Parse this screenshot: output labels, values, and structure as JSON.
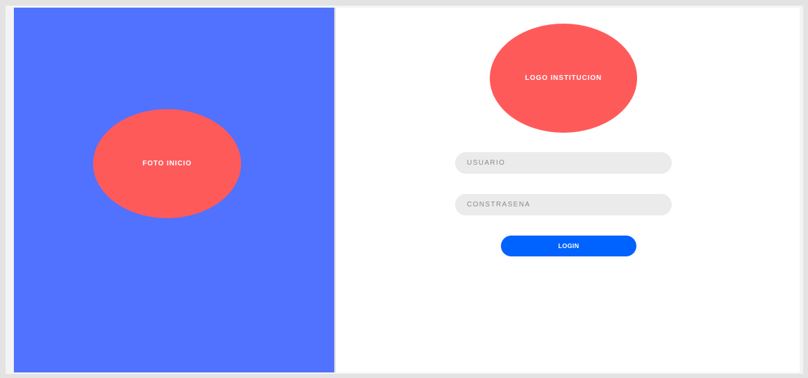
{
  "left_panel": {
    "photo_label": "FOTO INICIO",
    "background_color": "#5171ff",
    "ellipse_color": "#ff5a5a"
  },
  "right_panel": {
    "logo_label": "LOGO INSTITUCION",
    "username": {
      "placeholder": "USUARIO",
      "value": ""
    },
    "password": {
      "placeholder": "CONSTRASEÑA",
      "value": ""
    },
    "login_button": {
      "label": "LOGIN",
      "color": "#0062ff"
    },
    "field_color": "#ebebeb"
  }
}
